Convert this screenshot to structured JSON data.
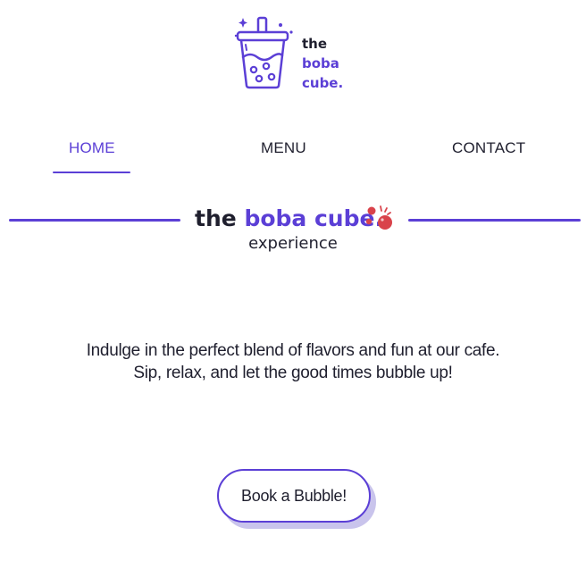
{
  "brand": {
    "logo_line1": "the",
    "logo_line2": "boba",
    "logo_line3": "cube.",
    "accent_color": "#5b3fd6",
    "bubble_color": "#d9434b"
  },
  "nav": {
    "items": [
      {
        "label": "HOME",
        "active": true
      },
      {
        "label": "MENU",
        "active": false
      },
      {
        "label": "CONTACT",
        "active": false
      }
    ]
  },
  "hero": {
    "title_the": "the",
    "title_brand": "boba cube.",
    "subtitle": "experience"
  },
  "tagline": {
    "line1": "Indulge in the perfect blend of flavors and fun at our cafe.",
    "line2": "Sip, relax, and let the good times bubble up!"
  },
  "cta": {
    "label": "Book a Bubble!"
  },
  "icons": [
    "boba-cup-icon",
    "bubbles-icon"
  ]
}
